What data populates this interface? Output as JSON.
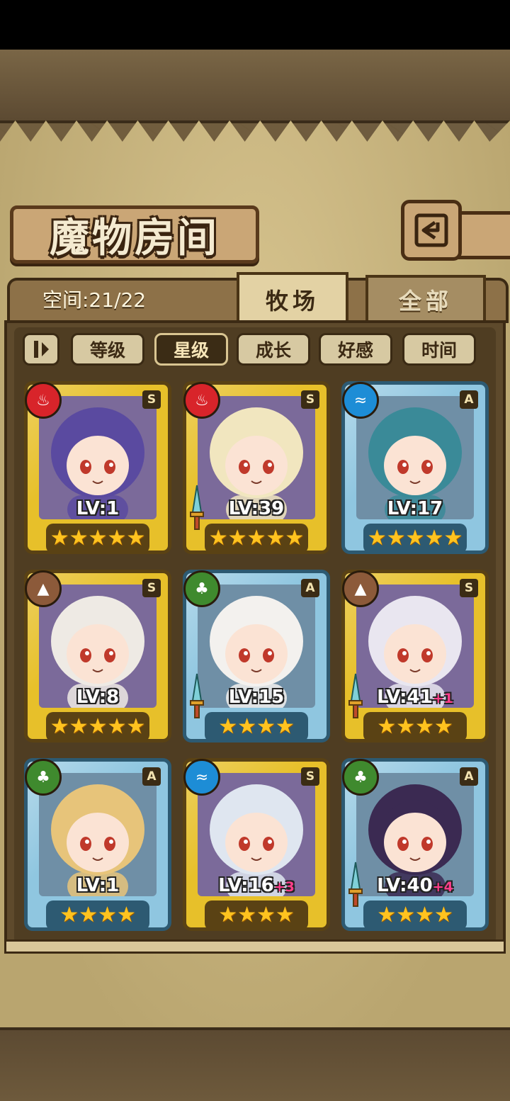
{
  "header": {
    "title": "魔物房间",
    "back_icon": "back-arrow-icon"
  },
  "storage": {
    "space_text": "空间:21/22"
  },
  "tabs": [
    {
      "label": "牧场",
      "active": true
    },
    {
      "label": "全部",
      "active": false
    }
  ],
  "sort_buttons": [
    {
      "label": "等级",
      "active": false
    },
    {
      "label": "星级",
      "active": true
    },
    {
      "label": "成长",
      "active": false
    },
    {
      "label": "好感",
      "active": false
    },
    {
      "label": "时间",
      "active": false
    }
  ],
  "cards": [
    {
      "element": "fire",
      "rank": "S",
      "level": "LV:1",
      "plus": "",
      "stars": 5,
      "frame": "gold",
      "has_weapon": false,
      "hair": "#5a4aa0"
    },
    {
      "element": "fire",
      "rank": "S",
      "level": "LV:39",
      "plus": "",
      "stars": 5,
      "frame": "gold",
      "has_weapon": true,
      "hair": "#f1e6bf"
    },
    {
      "element": "water",
      "rank": "A",
      "level": "LV:17",
      "plus": "",
      "stars": 5,
      "frame": "blue",
      "has_weapon": false,
      "hair": "#3a8a98"
    },
    {
      "element": "earth",
      "rank": "S",
      "level": "LV:8",
      "plus": "",
      "stars": 5,
      "frame": "gold",
      "has_weapon": false,
      "hair": "#eeeae4"
    },
    {
      "element": "wood",
      "rank": "A",
      "level": "LV:15",
      "plus": "",
      "stars": 4,
      "frame": "blue",
      "has_weapon": true,
      "hair": "#f3f1ee"
    },
    {
      "element": "earth",
      "rank": "S",
      "level": "LV:41",
      "plus": "+1",
      "stars": 4,
      "frame": "gold",
      "has_weapon": true,
      "hair": "#e9e6f0"
    },
    {
      "element": "wood",
      "rank": "A",
      "level": "LV:1",
      "plus": "",
      "stars": 4,
      "frame": "blue",
      "has_weapon": false,
      "hair": "#e7c47a"
    },
    {
      "element": "water",
      "rank": "S",
      "level": "LV:16",
      "plus": "+3",
      "stars": 4,
      "frame": "gold",
      "has_weapon": false,
      "hair": "#dfe6f0"
    },
    {
      "element": "wood",
      "rank": "A",
      "level": "LV:40",
      "plus": "+4",
      "stars": 4,
      "frame": "blue",
      "has_weapon": true,
      "hair": "#3b2a52"
    }
  ],
  "colors": {
    "fire": "#d8242a",
    "water": "#1d8dd6",
    "earth": "#8c5a3a",
    "wood": "#3f8a2e",
    "gold_frame": "#e7c02a",
    "blue_frame": "#8fc6e0",
    "star": "#ffc31f",
    "plus_level": "#ff3d8a"
  }
}
